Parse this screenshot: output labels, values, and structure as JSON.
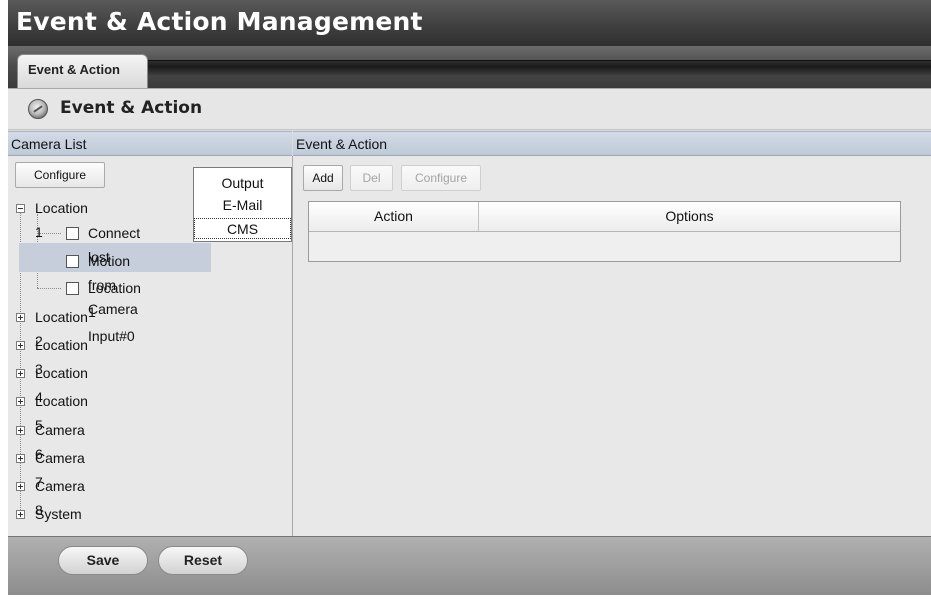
{
  "app": {
    "title": "Event & Action Management"
  },
  "tabs": [
    {
      "label": "Event & Action",
      "active": true
    }
  ],
  "section": {
    "title": "Event & Action",
    "icon": "gear-globe-icon"
  },
  "camera_list": {
    "header": "Camera List",
    "configure_label": "Configure",
    "tree": [
      {
        "label": "Location 1",
        "expanded": true,
        "children": [
          {
            "label": "Connect lost",
            "checked": false,
            "selected": true
          },
          {
            "label": "Motion from Camera",
            "checked": false
          },
          {
            "label": "Location 1 Input#0",
            "checked": false
          }
        ]
      },
      {
        "label": "Location 2",
        "expanded": false
      },
      {
        "label": "Location 3",
        "expanded": false
      },
      {
        "label": "Location 4",
        "expanded": false
      },
      {
        "label": "Location 5",
        "expanded": false
      },
      {
        "label": "Camera 6",
        "expanded": false
      },
      {
        "label": "Camera 7",
        "expanded": false
      },
      {
        "label": "Camera 8",
        "expanded": false
      },
      {
        "label": "System",
        "expanded": false
      }
    ]
  },
  "popup_menu": {
    "items": [
      "Output",
      "E-Mail",
      "CMS"
    ],
    "focused": "CMS"
  },
  "event_action": {
    "header": "Event & Action",
    "add_label": "Add",
    "del_label": "Del",
    "configure_label": "Configure",
    "columns": [
      "Action",
      "Options"
    ],
    "rows": []
  },
  "footer": {
    "save_label": "Save",
    "reset_label": "Reset"
  },
  "colors": {
    "title_bar": "#3e3e3e",
    "panel_header": "#c8d2df",
    "selection": "#c7cedb",
    "content_bg": "#e8e8e8"
  }
}
